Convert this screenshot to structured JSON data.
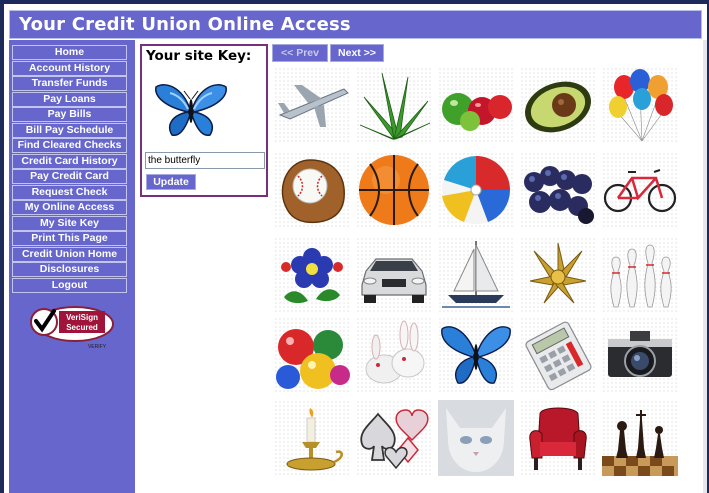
{
  "header": {
    "title": "Your Credit Union Online Access"
  },
  "sidebar": {
    "items": [
      {
        "label": "Home"
      },
      {
        "label": "Account History"
      },
      {
        "label": "Transfer Funds"
      },
      {
        "label": "Pay Loans"
      },
      {
        "label": "Pay Bills"
      },
      {
        "label": "Bill Pay Schedule"
      },
      {
        "label": "Find Cleared Checks"
      },
      {
        "label": "Credit Card History"
      },
      {
        "label": "Pay Credit Card"
      },
      {
        "label": "Request Check"
      },
      {
        "label": "My Online Access"
      },
      {
        "label": "My Site Key"
      },
      {
        "label": "Print This Page"
      },
      {
        "label": "Credit Union Home"
      },
      {
        "label": "Disclosures"
      },
      {
        "label": "Logout"
      }
    ],
    "seal": {
      "line1": "VeriSign",
      "line2": "Secured",
      "line3": "VERIFY"
    }
  },
  "site_key": {
    "title": "Your site Key:",
    "image": "butterfly-icon",
    "input_value": "the butterfly",
    "update_label": "Update"
  },
  "pager": {
    "prev_label": "<< Prev",
    "next_label": "Next >>"
  },
  "gallery": {
    "images": [
      "airplane",
      "aloe-plant",
      "apples",
      "avocado",
      "balloons",
      "baseball-glove",
      "basketball",
      "beach-ball",
      "berries",
      "bicycle",
      "blue-flower",
      "car",
      "sailboat",
      "gold-bow",
      "bowling-pins",
      "ornaments",
      "bunnies",
      "butterfly",
      "calculator",
      "camera",
      "candle",
      "card-suits",
      "white-cat",
      "red-chair",
      "chess"
    ]
  },
  "colors": {
    "accent": "#6666cc",
    "border": "#7a2f7a",
    "background": "#ffffff"
  }
}
